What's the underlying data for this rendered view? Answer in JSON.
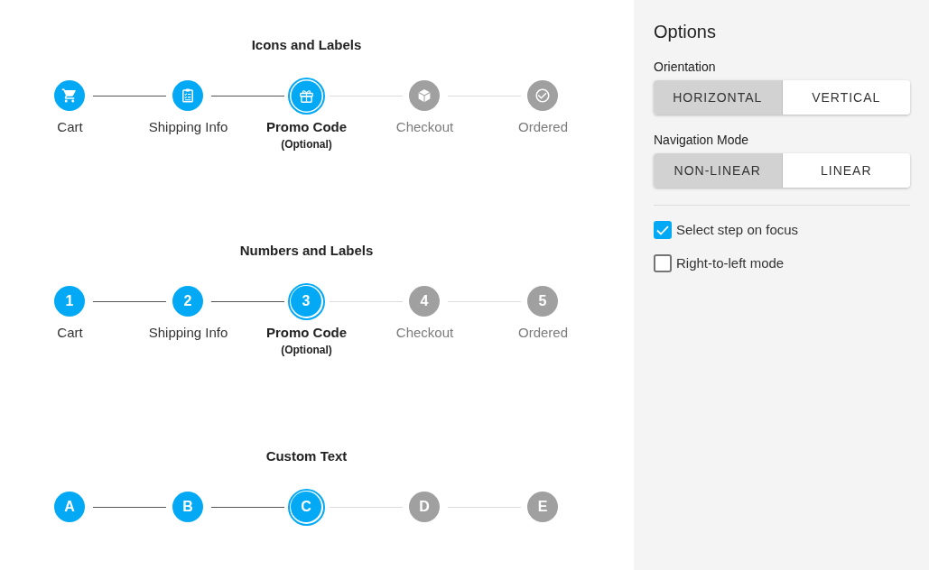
{
  "steppers": [
    {
      "title": "Icons and Labels",
      "kind": "icons",
      "steps": [
        {
          "label": "Cart",
          "completed": true,
          "selected": false
        },
        {
          "label": "Shipping Info",
          "completed": true,
          "selected": false
        },
        {
          "label": "Promo Code",
          "note": "(Optional)",
          "completed": false,
          "selected": true
        },
        {
          "label": "Checkout",
          "completed": false,
          "selected": false
        },
        {
          "label": "Ordered",
          "completed": false,
          "selected": false
        }
      ]
    },
    {
      "title": "Numbers and Labels",
      "kind": "markers",
      "steps": [
        {
          "marker": "1",
          "label": "Cart",
          "completed": true,
          "selected": false
        },
        {
          "marker": "2",
          "label": "Shipping Info",
          "completed": true,
          "selected": false
        },
        {
          "marker": "3",
          "label": "Promo Code",
          "note": "(Optional)",
          "completed": false,
          "selected": true
        },
        {
          "marker": "4",
          "label": "Checkout",
          "completed": false,
          "selected": false
        },
        {
          "marker": "5",
          "label": "Ordered",
          "completed": false,
          "selected": false
        }
      ]
    },
    {
      "title": "Custom Text",
      "kind": "markers",
      "steps": [
        {
          "marker": "A",
          "completed": true,
          "selected": false
        },
        {
          "marker": "B",
          "completed": true,
          "selected": false
        },
        {
          "marker": "C",
          "completed": false,
          "selected": true
        },
        {
          "marker": "D",
          "completed": false,
          "selected": false
        },
        {
          "marker": "E",
          "completed": false,
          "selected": false
        }
      ]
    }
  ],
  "options": {
    "title": "Options",
    "groups": [
      {
        "label": "Orientation",
        "buttons": [
          {
            "label": "HORIZONTAL",
            "selected": true
          },
          {
            "label": "VERTICAL",
            "selected": false
          }
        ]
      },
      {
        "label": "Navigation Mode",
        "buttons": [
          {
            "label": "NON-LINEAR",
            "selected": true
          },
          {
            "label": "LINEAR",
            "selected": false
          }
        ]
      }
    ],
    "checkboxes": [
      {
        "label": "Select step on focus",
        "checked": true
      },
      {
        "label": "Right-to-left mode",
        "checked": false
      }
    ]
  }
}
